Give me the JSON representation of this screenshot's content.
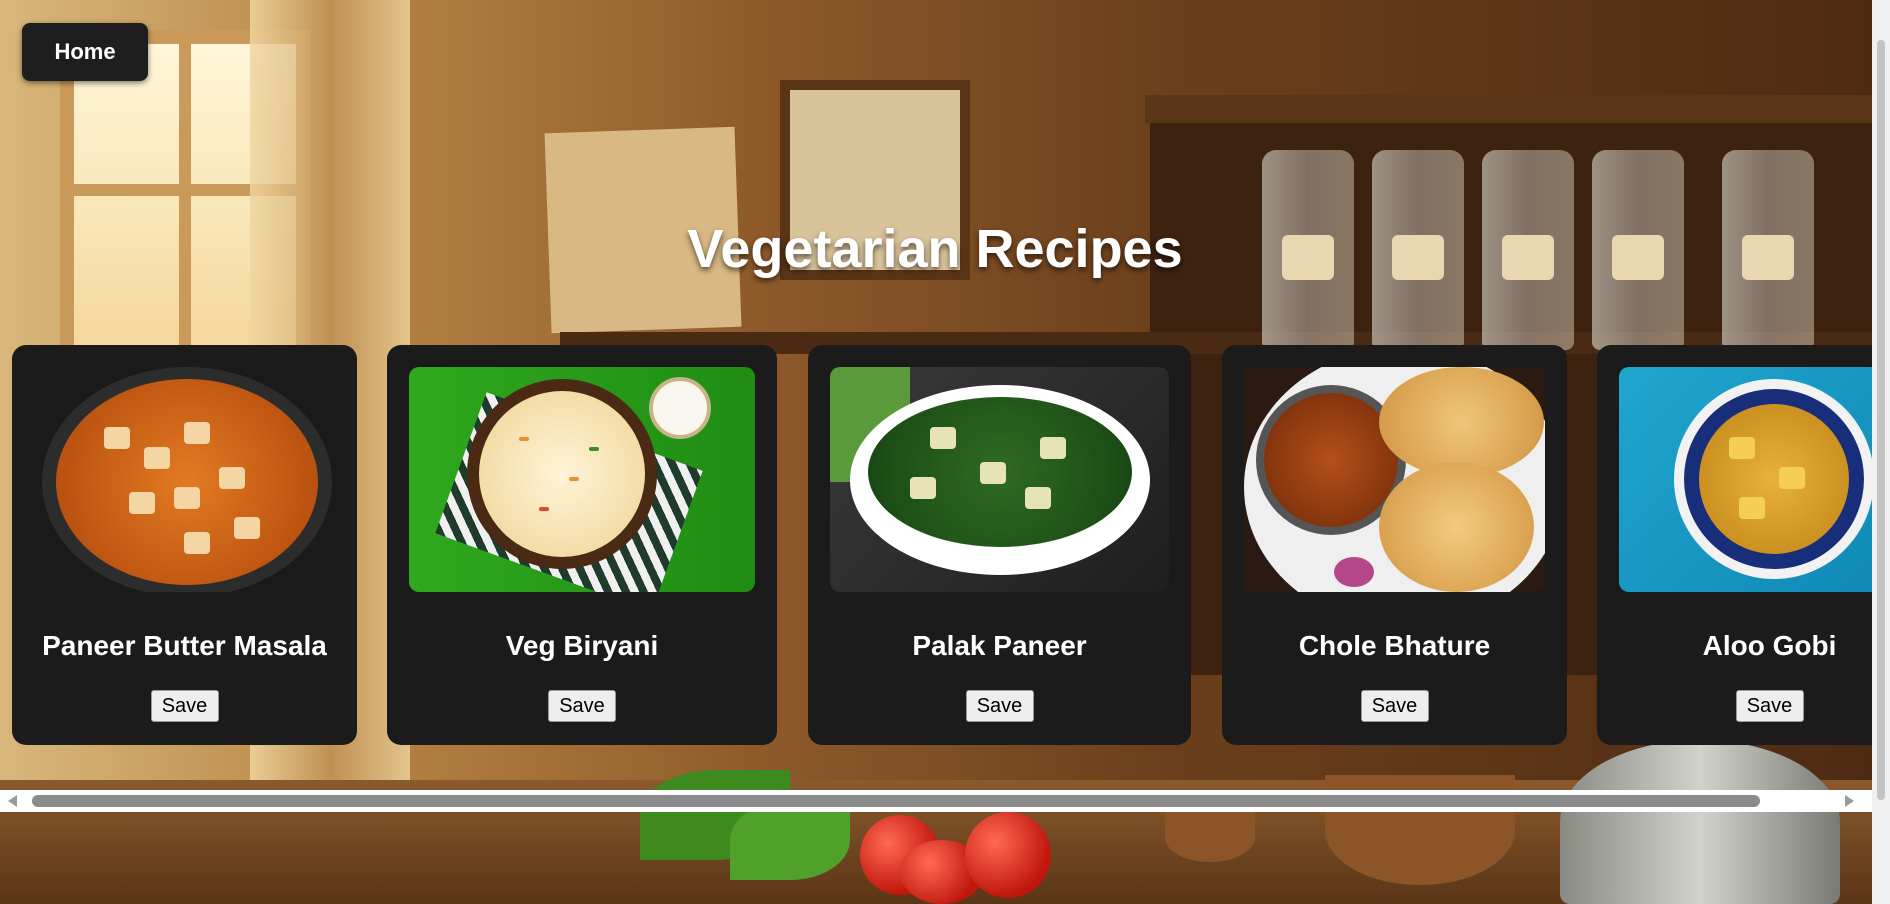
{
  "nav": {
    "home_label": "Home"
  },
  "page": {
    "title": "Vegetarian Recipes"
  },
  "recipes": [
    {
      "name": "Paneer Butter Masala",
      "save_label": "Save"
    },
    {
      "name": "Veg Biryani",
      "save_label": "Save"
    },
    {
      "name": "Palak Paneer",
      "save_label": "Save"
    },
    {
      "name": "Chole Bhature",
      "save_label": "Save"
    },
    {
      "name": "Aloo Gobi",
      "save_label": "Save"
    }
  ],
  "colors": {
    "card_background": "#1b1b1b",
    "home_button": "#1e1e1e",
    "title_text": "#ffffff",
    "save_button": "#eeeeee"
  },
  "icons": {
    "scroll_left": "scroll-left-arrow-icon",
    "scroll_right": "scroll-right-arrow-icon"
  }
}
